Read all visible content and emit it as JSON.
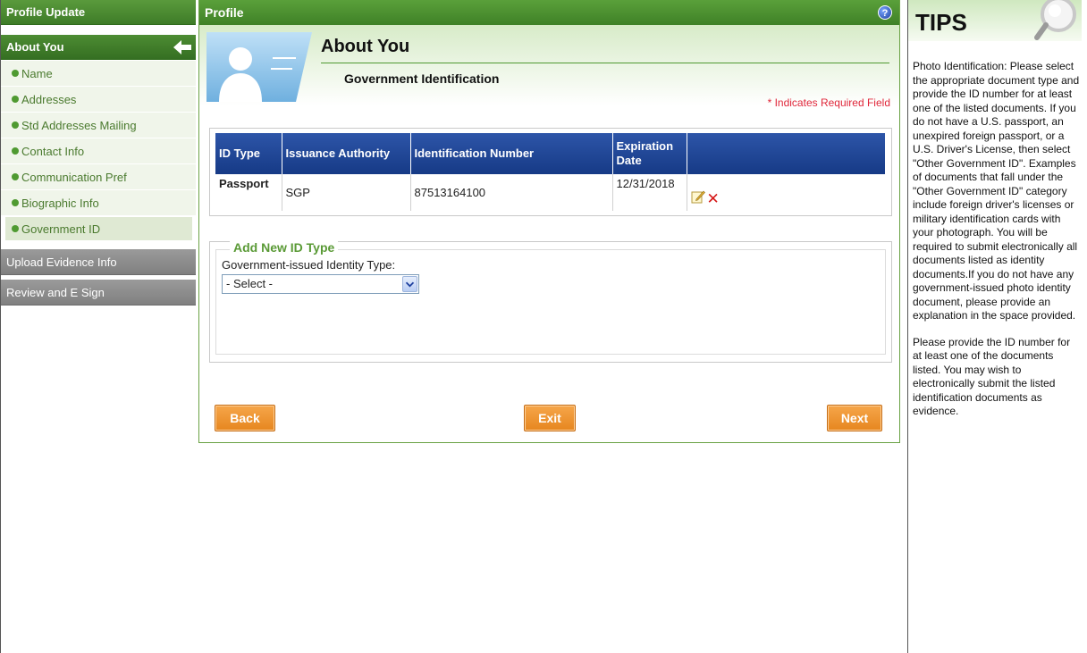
{
  "sidebar": {
    "header": "Profile Update",
    "section": "About You",
    "items": [
      {
        "label": "Name"
      },
      {
        "label": "Addresses"
      },
      {
        "label": "Std Addresses Mailing"
      },
      {
        "label": "Contact Info"
      },
      {
        "label": "Communication Pref"
      },
      {
        "label": "Biographic Info"
      },
      {
        "label": "Government ID",
        "active": true
      }
    ],
    "upload": "Upload Evidence Info",
    "review": "Review and E Sign"
  },
  "main": {
    "bar_title": "Profile",
    "help": "?",
    "page_title": "About You",
    "section_title": "Government Identification",
    "required_note": "* Indicates Required Field",
    "table": {
      "columns": [
        "ID Type",
        "Issuance Authority",
        "Identification Number",
        "Expiration Date",
        ""
      ],
      "rows": [
        {
          "id_type": "Passport",
          "authority": "SGP",
          "number": "87513164100",
          "expiration": "12/31/2018"
        }
      ]
    },
    "add": {
      "legend": "Add New ID Type",
      "label": "Government-issued Identity Type:",
      "selected": "- Select -"
    },
    "buttons": {
      "back": "Back",
      "exit": "Exit",
      "next": "Next"
    }
  },
  "tips": {
    "title": "TIPS",
    "paragraph1": "Photo Identification: Please select the appropriate document type and provide the ID number for at least one of the listed documents. If you do not have a U.S. passport, an unexpired foreign passport, or a U.S. Driver's License, then select \"Other Government ID\". Examples of documents that fall under the \"Other Government ID\" category include foreign driver's licenses or military identification cards with your photograph. You will be required to submit electronically all documents listed as identity documents.If you do not have any government-issued photo identity document, please provide an explanation in the space provided.",
    "paragraph2": "Please provide the ID number for at least one of the documents listed. You may wish to electronically submit the listed identification documents as evidence."
  },
  "colors": {
    "brand_green": "#4a8f2f",
    "table_header_blue": "#1f4496",
    "button_orange": "#ee9634",
    "required_red": "#e0263a"
  }
}
